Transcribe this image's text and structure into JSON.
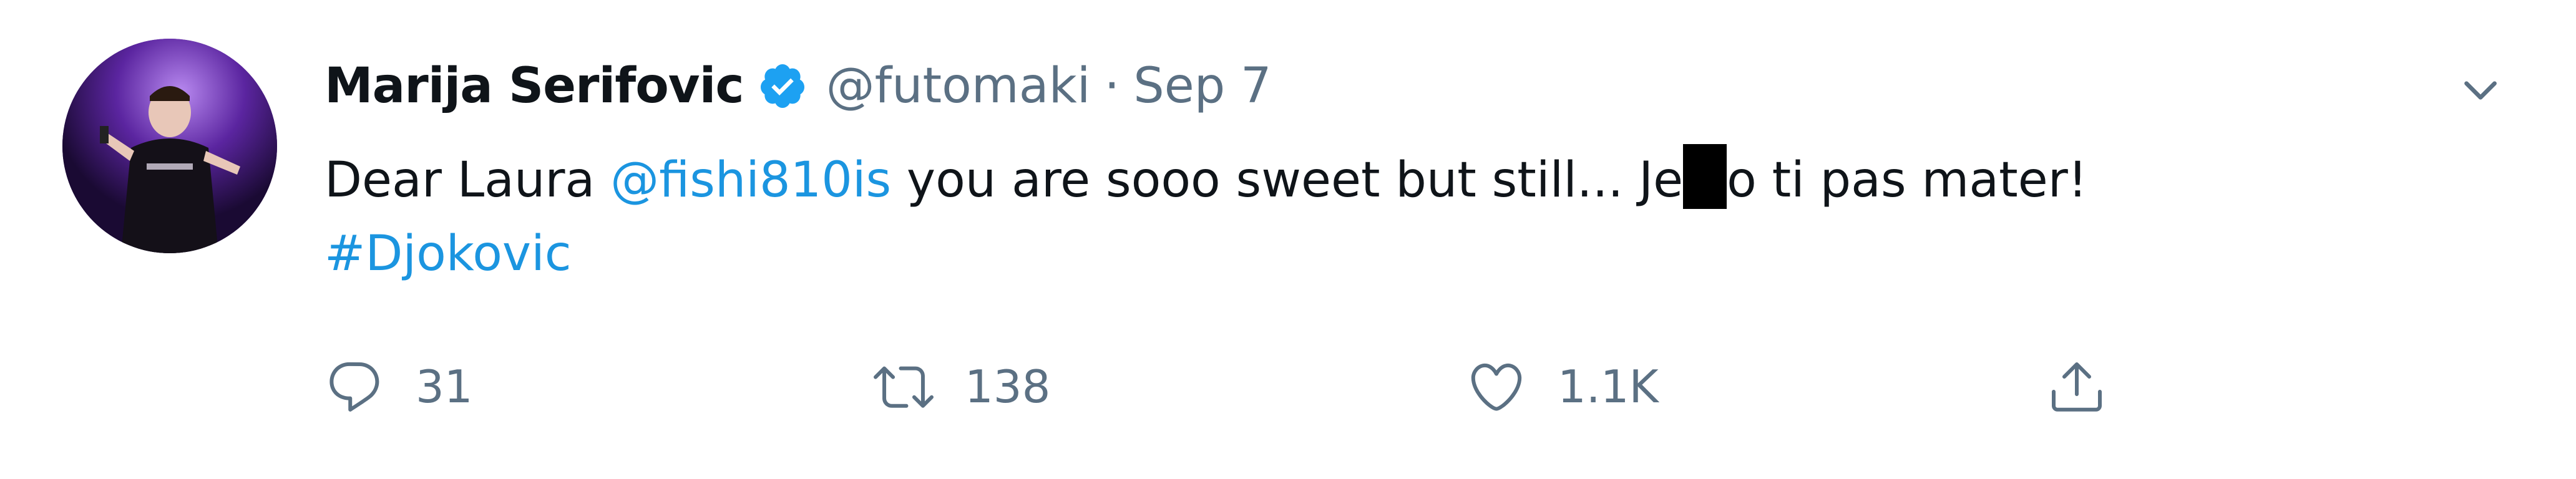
{
  "tweet": {
    "display_name": "Marija Serifovic",
    "handle": "@futomaki",
    "separator": "·",
    "date": "Sep 7",
    "text_parts": {
      "before_mention": "Dear Laura ",
      "mention": "@fishi810is",
      "middle": " you are sooo sweet but still... Je",
      "after_redaction": "o ti pas mater!",
      "hashtag": "#Djokovic"
    },
    "actions": {
      "reply_count": "31",
      "retweet_count": "138",
      "like_count": "1.1K"
    }
  },
  "icons": {
    "verified": "verified-badge-icon",
    "more": "chevron-down-icon",
    "reply": "reply-icon",
    "retweet": "retweet-icon",
    "like": "heart-icon",
    "share": "share-icon"
  },
  "colors": {
    "link": "#1b95e0",
    "secondary_text": "#5b7083",
    "primary_text": "#0f1419",
    "verified": "#1da1f2"
  }
}
